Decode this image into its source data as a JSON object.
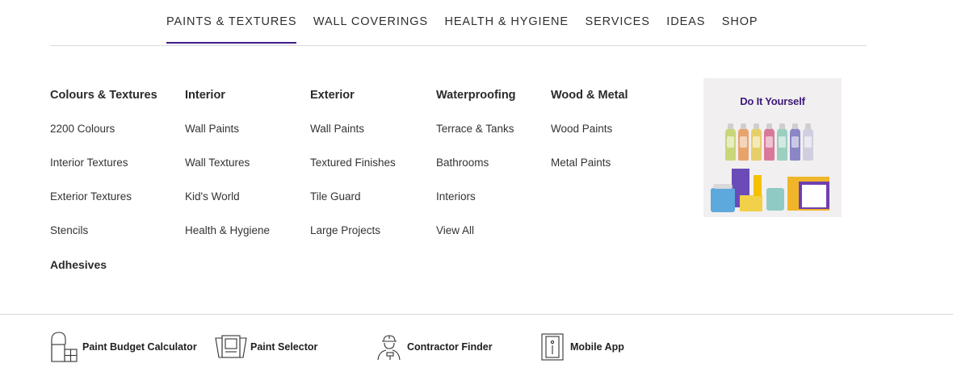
{
  "topnav": {
    "items": [
      {
        "label": "PAINTS & TEXTURES",
        "active": true
      },
      {
        "label": "WALL COVERINGS",
        "active": false
      },
      {
        "label": "HEALTH & HYGIENE",
        "active": false
      },
      {
        "label": "SERVICES",
        "active": false
      },
      {
        "label": "IDEAS",
        "active": false
      },
      {
        "label": "SHOP",
        "active": false
      }
    ],
    "accent_color": "#3f1c8c"
  },
  "menu": {
    "colours_textures": {
      "heading": "Colours & Textures",
      "items": [
        "2200 Colours",
        "Interior Textures",
        "Exterior Textures",
        "Stencils",
        "Adhesives"
      ]
    },
    "interior": {
      "heading": "Interior",
      "items": [
        "Wall Paints",
        "Wall Textures",
        "Kid's World",
        "Health & Hygiene"
      ]
    },
    "exterior": {
      "heading": "Exterior",
      "items": [
        "Wall Paints",
        "Textured Finishes",
        "Tile Guard",
        "Large Projects"
      ]
    },
    "waterproofing": {
      "heading": "Waterproofing",
      "items": [
        "Terrace & Tanks",
        "Bathrooms",
        "Interiors",
        "View All"
      ]
    },
    "wood_metal": {
      "heading": "Wood & Metal",
      "items": [
        "Wood Paints",
        "Metal Paints"
      ]
    }
  },
  "promo": {
    "title": "Do It Yourself",
    "title_color": "#3d1a7a"
  },
  "tools": [
    {
      "label": "Paint Budget Calculator",
      "icon": "calculator-icon"
    },
    {
      "label": "Paint Selector",
      "icon": "swatch-icon"
    },
    {
      "label": "Contractor Finder",
      "icon": "contractor-icon"
    },
    {
      "label": "Mobile App",
      "icon": "mobile-icon"
    }
  ]
}
